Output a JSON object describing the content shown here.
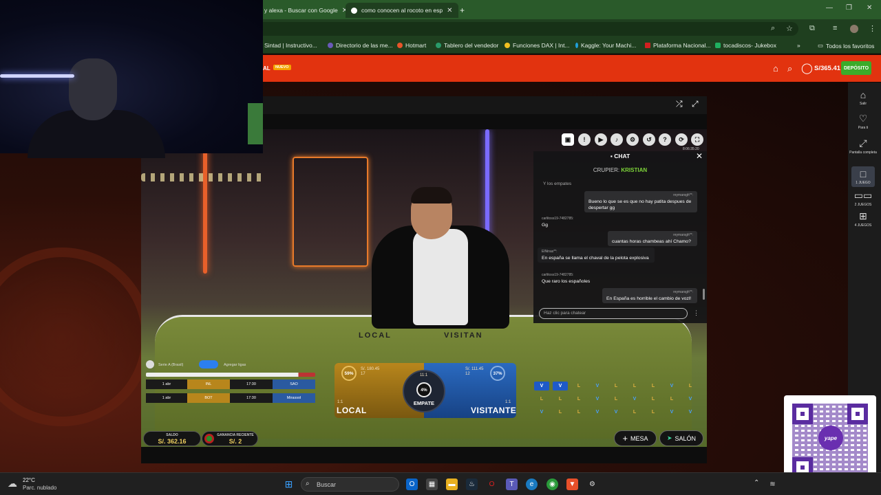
{
  "browser": {
    "tabs": [
      {
        "label": "y alexa - Buscar con Google"
      },
      {
        "label": "como conocen al rocoto en esp"
      }
    ],
    "new_tab": "+",
    "bookmarks": [
      {
        "label": "Sintad | Instructivo...",
        "color": "#6aa0d8"
      },
      {
        "label": "Directorio de las me...",
        "color": "#6a5ab8"
      },
      {
        "label": "Hotmart",
        "color": "#e8552a"
      },
      {
        "label": "Tablero del vendedor",
        "color": "#2a9a6a"
      },
      {
        "label": "Funciones DAX | Int...",
        "color": "#f0c020"
      },
      {
        "label": "Kaggle: Your Machi...",
        "color": "#20a0d8"
      },
      {
        "label": "Plataforma Nacional...",
        "color": "#d02020"
      },
      {
        "label": "tocadiscos- Jukebox",
        "color": "#20b060"
      }
    ],
    "all_favorites": "Todos los favoritos"
  },
  "site": {
    "brand_tail": "CIAL",
    "brand_badge": "NUEVO",
    "balance": "S/365.41",
    "deposit": "DEPÓSITO",
    "accent": "#e2330f"
  },
  "chat": {
    "title": "CHAT",
    "croupier_label": "CRUPIER:",
    "croupier_name": "KRISTIAN",
    "sub_header": "Y los empates",
    "messages": [
      {
        "user": "reymarsgh**:",
        "text": "Bueno lo que se es que no hay patita despues de despertar gg",
        "side": "right"
      },
      {
        "user": "carlitoss19-7482785:",
        "text": "Gg",
        "side": "left"
      },
      {
        "user": "reymarsgh**:",
        "text": "cuantas horas chambeas ahí Chamo?",
        "side": "right"
      },
      {
        "user": "ElNinas**:",
        "text": "En españa se llama el chaval de la pelota explosiva",
        "side": "left"
      },
      {
        "user": "carlitoss19-7482785:",
        "text": "Que raro los españoles",
        "side": "left"
      },
      {
        "user": "reymarsgh**:",
        "text": "En España es horrible el cambio de vozl!",
        "side": "right"
      }
    ],
    "input_placeholder": "Haz clic para chatear",
    "timestamp": "8:06:35:20"
  },
  "matches": {
    "league": "Serie A (Brasil)",
    "add_leagues": "Agregar ligas",
    "rows": [
      {
        "date": "1 abr",
        "home": "INL",
        "time": "17:30",
        "away": "SAO"
      },
      {
        "date": "1 abr",
        "home": "BOT",
        "time": "17:30",
        "away": "Mirassol"
      }
    ]
  },
  "bets": {
    "local": {
      "label": "LOCAL",
      "pct": "59%",
      "odds": "1:1",
      "amount": "S/. 180.45",
      "count": "17"
    },
    "draw": {
      "label": "EMPATE",
      "pct": "4%",
      "odds": "11:1"
    },
    "visit": {
      "label": "VISITANTE",
      "pct": "37%",
      "odds": "1:1",
      "amount": "S/. 111.45",
      "count": "12"
    }
  },
  "table_text": {
    "local": "LOCAL",
    "visit": "VISITAN"
  },
  "roadmap": [
    [
      "V",
      "V",
      "L",
      "V",
      "L",
      "L",
      "L",
      "V",
      "L"
    ],
    [
      "L",
      "L",
      "L",
      "V",
      "L",
      "V",
      "L",
      "L",
      "V"
    ],
    [
      "V",
      "L",
      "L",
      "V",
      "V",
      "L",
      "L",
      "V",
      "V"
    ]
  ],
  "footer": {
    "saldo_label": "SALDO",
    "saldo_value": "S/. 362.16",
    "ganancia_label": "GANANCIA RECIENTE",
    "ganancia_value": "S/. 2",
    "mesa": "MESA",
    "salon": "SALÓN"
  },
  "sidebar": [
    {
      "label": "Salir",
      "icon": "home-icon"
    },
    {
      "label": "Para ti",
      "icon": "heart-icon"
    },
    {
      "label": "Pantalla completa",
      "icon": "fullscreen-icon"
    },
    {
      "label": "1 JUEGO",
      "icon": "one-game-icon"
    },
    {
      "label": "2 JUEGOS",
      "icon": "two-games-icon"
    },
    {
      "label": "4 JUEGOS",
      "icon": "four-games-icon"
    }
  ],
  "qr": {
    "logo": "yape"
  },
  "taskbar": {
    "temp": "22°C",
    "weather": "Parc. nublado",
    "search": "Buscar"
  }
}
